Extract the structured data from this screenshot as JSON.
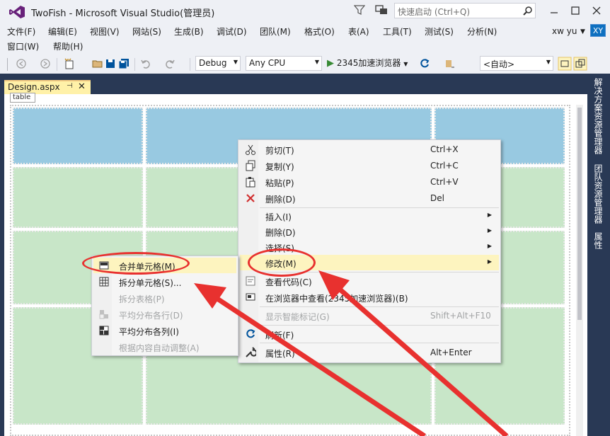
{
  "window": {
    "title": "TwoFish - Microsoft Visual Studio(管理员)",
    "quick_launch_placeholder": "快速启动 (Ctrl+Q)",
    "user_name": "xw yu",
    "avatar_initials": "XY"
  },
  "menu": {
    "items": [
      "文件(F)",
      "编辑(E)",
      "视图(V)",
      "网站(S)",
      "生成(B)",
      "调试(D)",
      "团队(M)",
      "格式(O)",
      "表(A)",
      "工具(T)",
      "测试(S)",
      "分析(N)"
    ],
    "row2": [
      "窗口(W)",
      "帮助(H)"
    ]
  },
  "toolbar": {
    "config": "Debug",
    "platform": "Any CPU",
    "run_label": "2345加速浏览器",
    "auto": "<自动>"
  },
  "document": {
    "tab_label": "Design.aspx",
    "tag_label": "table"
  },
  "side_panel": {
    "tabs": [
      "解决方案资源管理器",
      "团队资源管理器",
      "属性"
    ]
  },
  "context_menu": {
    "items": [
      {
        "label": "剪切(T)",
        "shortcut": "Ctrl+X",
        "icon": "scissors-icon"
      },
      {
        "label": "复制(Y)",
        "shortcut": "Ctrl+C",
        "icon": "copy-icon"
      },
      {
        "label": "粘贴(P)",
        "shortcut": "Ctrl+V",
        "icon": "paste-icon"
      },
      {
        "label": "删除(D)",
        "shortcut": "Del",
        "icon": "delete-x-icon"
      },
      {
        "label": "插入(I)",
        "shortcut": "",
        "icon": ""
      },
      {
        "label": "删除(D)",
        "shortcut": "",
        "icon": ""
      },
      {
        "label": "选择(S)",
        "shortcut": "",
        "icon": ""
      },
      {
        "label": "修改(M)",
        "shortcut": "",
        "icon": ""
      },
      {
        "label": "查看代码(C)",
        "shortcut": "",
        "icon": "code-icon"
      },
      {
        "label": "在浏览器中查看(2345加速浏览器)(B)",
        "shortcut": "",
        "icon": "browser-icon"
      },
      {
        "label": "显示智能标记(G)",
        "shortcut": "Shift+Alt+F10",
        "icon": ""
      },
      {
        "label": "刷新(F)",
        "shortcut": "",
        "icon": "refresh-icon"
      },
      {
        "label": "属性(R)",
        "shortcut": "Alt+Enter",
        "icon": "wrench-icon"
      }
    ]
  },
  "submenu": {
    "items": [
      {
        "label": "合并单元格(M)",
        "icon": "merge-cells-icon"
      },
      {
        "label": "拆分单元格(S)...",
        "icon": "split-cells-icon"
      },
      {
        "label": "拆分表格(P)",
        "icon": ""
      },
      {
        "label": "平均分布各行(D)",
        "icon": "distribute-rows-icon"
      },
      {
        "label": "平均分布各列(I)",
        "icon": "distribute-cols-icon"
      },
      {
        "label": "根据内容自动调整(A)",
        "icon": ""
      }
    ]
  }
}
